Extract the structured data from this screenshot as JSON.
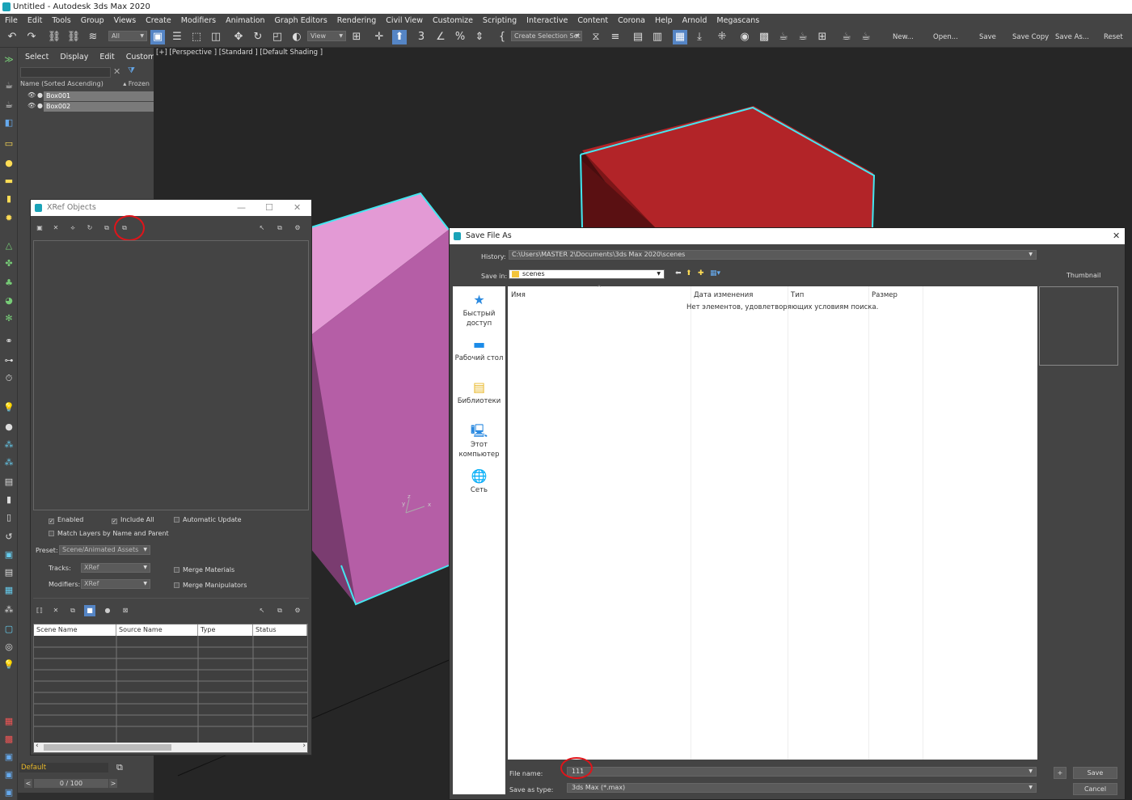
{
  "app": {
    "title": "Untitled - Autodesk 3ds Max 2020"
  },
  "menu": [
    "File",
    "Edit",
    "Tools",
    "Group",
    "Views",
    "Create",
    "Modifiers",
    "Animation",
    "Graph Editors",
    "Rendering",
    "Civil View",
    "Customize",
    "Scripting",
    "Interactive",
    "Content",
    "Corona",
    "Help",
    "Arnold",
    "Megascans"
  ],
  "toolbar": {
    "filter_all": "All",
    "view_dropdown": "View",
    "create_selection_set": "Create Selection Set",
    "new": "New...",
    "open": "Open...",
    "save": "Save",
    "save_copy": "Save Copy",
    "save_as": "Save As...",
    "reset": "Reset"
  },
  "scene_explorer": {
    "tabs": [
      "Select",
      "Display",
      "Edit",
      "Customize"
    ],
    "col_name": "Name (Sorted Ascending)",
    "col_frozen": "Frozen",
    "items": [
      "Box001",
      "Box002"
    ]
  },
  "viewport": {
    "label": "[+] [Perspective ] [Standard ] [Default Shading ]",
    "axis_x": "x",
    "axis_y": "y",
    "axis_z": "z"
  },
  "xref": {
    "title": "XRef Objects",
    "enabled": "Enabled",
    "include_all": "Include All",
    "automatic_update": "Automatic Update",
    "match_layers": "Match Layers by Name and Parent",
    "preset_label": "Preset:",
    "preset_value": "Scene/Animated Assets",
    "tracks_label": "Tracks:",
    "tracks_value": "XRef",
    "modifiers_label": "Modifiers:",
    "modifiers_value": "XRef",
    "merge_materials": "Merge Materials",
    "merge_manipulators": "Merge Manipulators",
    "columns": [
      "Scene Name",
      "Source Name",
      "Type",
      "Status"
    ]
  },
  "save_as": {
    "title": "Save File As",
    "history_label": "History:",
    "history_value": "C:\\Users\\MASTER 2\\Documents\\3ds Max 2020\\scenes",
    "save_in_label": "Save in:",
    "save_in_value": "scenes",
    "thumbnail_label": "Thumbnail",
    "places": [
      {
        "label": "Быстрый доступ"
      },
      {
        "label": "Рабочий стол"
      },
      {
        "label": "Библиотеки"
      },
      {
        "label": "Этот компьютер"
      },
      {
        "label": "Сеть"
      }
    ],
    "columns": [
      "Имя",
      "Дата изменения",
      "Тип",
      "Размер"
    ],
    "empty_message": "Нет элементов, удовлетворяющих условиям поиска.",
    "file_name_label": "File name:",
    "file_name_value": "111",
    "save_type_label": "Save as type:",
    "save_type_value": "3ds Max (*.max)",
    "plus": "+",
    "save_button": "Save",
    "cancel_button": "Cancel"
  },
  "bottom": {
    "layer": "Default",
    "timeline": "0 / 100",
    "prev": "<",
    "next": ">"
  },
  "colors": {
    "accent": "#5585c5",
    "selection": "#45e6f0",
    "box_red": "#b22428",
    "box_pink": "#d98dcc",
    "annotation": "#e0141a"
  }
}
